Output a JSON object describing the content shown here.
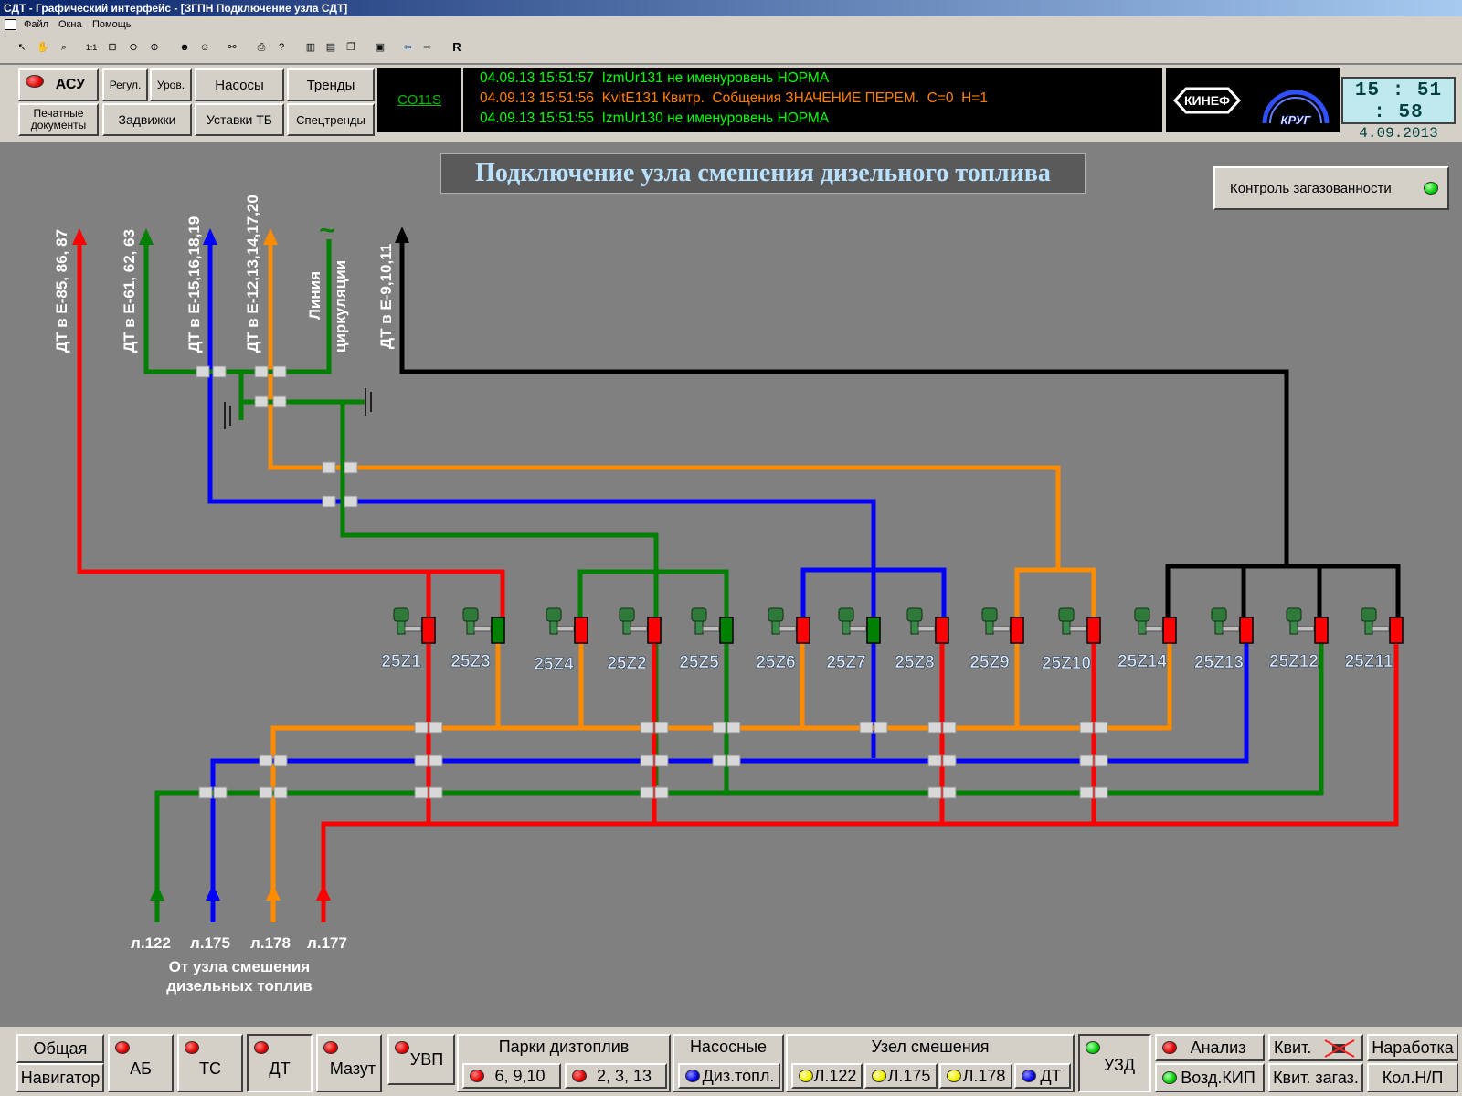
{
  "window": {
    "title": "СДТ - Графический интерфейс - [ЗГПН Подключение узла СДТ]",
    "menu": [
      "Файл",
      "Окна",
      "Помощь"
    ],
    "controls": [
      "_",
      "□",
      "×"
    ]
  },
  "toolbar": {
    "tools": [
      "arrow",
      "hand",
      "zoom",
      "1:1",
      "zoom-fit",
      "zoom-out",
      "zoom-in",
      "person",
      "person-x",
      "binoculars",
      "print",
      "help",
      "layout1",
      "layout2",
      "layout3",
      "window",
      "back",
      "forward"
    ],
    "r_label": "R"
  },
  "header": {
    "buttons": {
      "asu": "АСУ",
      "regul": "Регул.",
      "urov": "Уров.",
      "nasosy": "Насосы",
      "trendy": "Тренды",
      "pechat": "Печатные документы",
      "zadvizhki": "Задвижки",
      "ustavki": "Уставки ТБ",
      "spectrendy": "Спецтренды"
    },
    "station": "CO11S",
    "messages": [
      {
        "text": "04.09.13 15:51:57  IzmUr131 не именуровень НОРМА",
        "color": "#00ff00"
      },
      {
        "text": "04.09.13 15:51:56  KvitE131 Квитр.  Собщения ЗНАЧЕНИЕ ПЕРЕМ.  С=0  Н=1",
        "color": "#ff8000"
      },
      {
        "text": "04.09.13 15:51:55  IzmUr130 не именуровень НОРМА",
        "color": "#00ff00"
      }
    ],
    "logo_kinef": "КИНЕФ",
    "logo_krug": "КРУГ",
    "clock_time": "15 : 51 : 58",
    "clock_date": "4.09.2013"
  },
  "main": {
    "title": "Подключение узла смешения дизельного топлива",
    "gas_button": "Контроль загазованности",
    "pipe_colors": {
      "red": "#ff0000",
      "green": "#008000",
      "blue": "#0000ff",
      "orange": "#ff8c00",
      "black": "#000000"
    },
    "outlets": [
      "ДТ в Е-85, 86, 87",
      "ДТ в Е-61, 62, 63",
      "ДТ в Е-15,16,18,19",
      "ДТ в Е-12,13,14,17,20",
      "Линия",
      "циркуляции",
      "ДТ в Е-9,10,11"
    ],
    "tilde": "~",
    "valves": [
      "25Z1",
      "25Z3",
      "25Z4",
      "25Z2",
      "25Z5",
      "25Z6",
      "25Z7",
      "25Z8",
      "25Z9",
      "25Z10",
      "25Z14",
      "25Z13",
      "25Z12",
      "25Z11"
    ],
    "inlets": [
      "л.122",
      "л.175",
      "л.178",
      "л.177"
    ],
    "inlet_caption_1": "От узла смешения",
    "inlet_caption_2": "дизельных топлив"
  },
  "footer": {
    "obshaya": "Общая",
    "navigator": "Навигатор",
    "ab": "АБ",
    "ts": "ТС",
    "dt": "ДТ",
    "mazut": "Мазут",
    "uvp": "УВП",
    "parki_title": "Парки дизтоплив",
    "parki_1": "6, 9,10",
    "parki_2": "2, 3, 13",
    "nasosnye_title": "Насосные",
    "diz_topl": "Диз.топл.",
    "uzel_title": "Узел смешения",
    "l122": "Л.122",
    "l175": "Л.175",
    "l178": "Л.178",
    "uzel_dt": "ДТ",
    "uzd": "УЗД",
    "analiz": "Анализ",
    "vozd_kip": "Возд.КИП",
    "kvit": "Квит.",
    "kvit_zagaz": "Квит. загаз.",
    "narabotka": "Наработка",
    "kol_np": "Кол.Н/П"
  }
}
